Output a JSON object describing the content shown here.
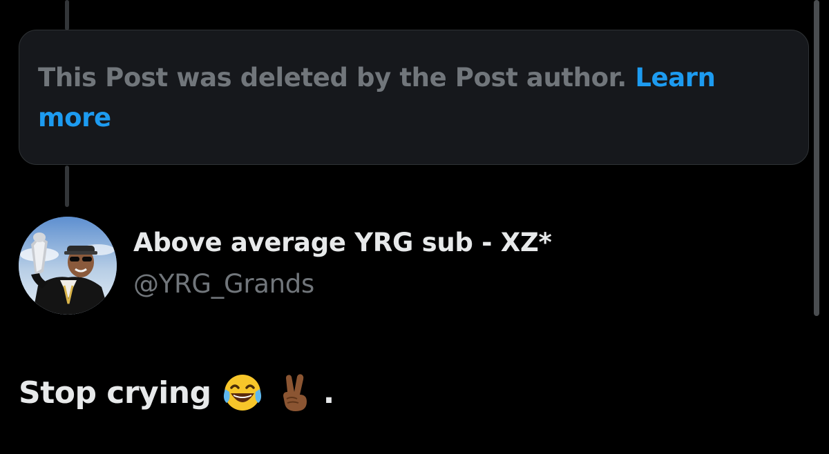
{
  "deleted_notice": {
    "text": "This Post was deleted by the Post author.",
    "link_label": "Learn more"
  },
  "author": {
    "display_name": "Above average YRG sub - XZ*",
    "handle": "@YRG_Grands"
  },
  "post": {
    "text": "Stop crying",
    "emojis": [
      "face-with-tears-of-joy-icon",
      "victory-hand-icon"
    ],
    "trailing": "."
  },
  "colors": {
    "background": "#000000",
    "card": "#16181c",
    "muted_text": "#71767b",
    "link": "#1d9bf0",
    "primary_text": "#e7e9ea"
  }
}
